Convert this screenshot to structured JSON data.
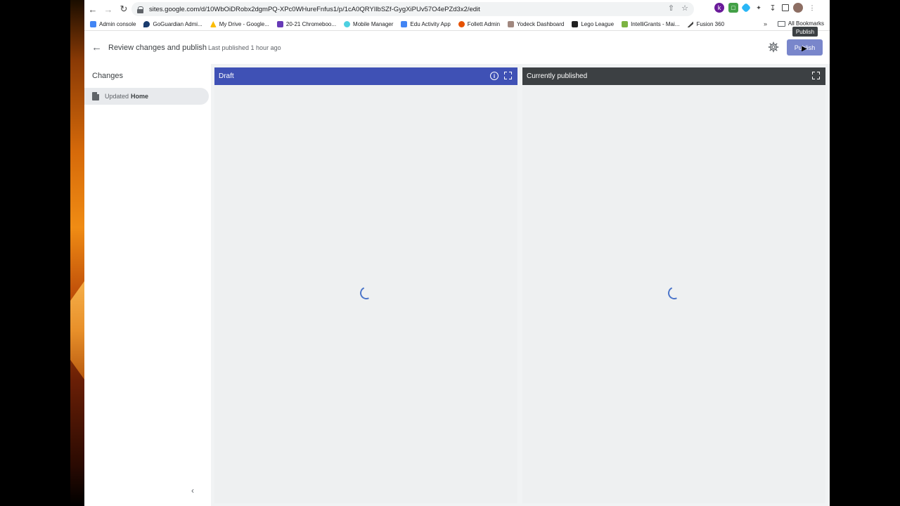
{
  "browser": {
    "url": "sites.google.com/d/10WbOiDRobx2dgmPQ-XPc0WHureFnfus1/p/1cA0QRYIlbSZf-GygXiPUv57O4ePZd3x2/edit",
    "bookmarks": [
      {
        "label": "Admin console",
        "color": "#4285f4"
      },
      {
        "label": "GoGuardian Admi...",
        "color": "#1a3c6e"
      },
      {
        "label": "My Drive - Google...",
        "color": "#fbbc04"
      },
      {
        "label": "20-21 Chromeboo...",
        "color": "#673ab7"
      },
      {
        "label": "Mobile Manager",
        "color": "#4dd0e1"
      },
      {
        "label": "Edu Activity App",
        "color": "#4285f4"
      },
      {
        "label": "Follett Admin",
        "color": "#e65100"
      },
      {
        "label": "Yodeck Dashboard",
        "color": "#a1887f"
      },
      {
        "label": "Lego League",
        "color": "#212121"
      },
      {
        "label": "IntelliGrants - Mai...",
        "color": "#7cb342"
      },
      {
        "label": "Fusion 360",
        "color": "#424242"
      }
    ],
    "overflow_label": "»",
    "all_bookmarks_label": "All Bookmarks"
  },
  "header": {
    "title": "Review changes and publish",
    "subtitle": "Last published 1 hour ago",
    "publish_label": "Publish",
    "publish_tooltip": "Publish",
    "accent_color": "#7986cb"
  },
  "sidebar": {
    "heading": "Changes",
    "items": [
      {
        "prefix": "Updated",
        "page": "Home"
      }
    ]
  },
  "panes": {
    "draft": {
      "label": "Draft",
      "color": "#3f51b5"
    },
    "published": {
      "label": "Currently published",
      "color": "#3c4043"
    }
  }
}
